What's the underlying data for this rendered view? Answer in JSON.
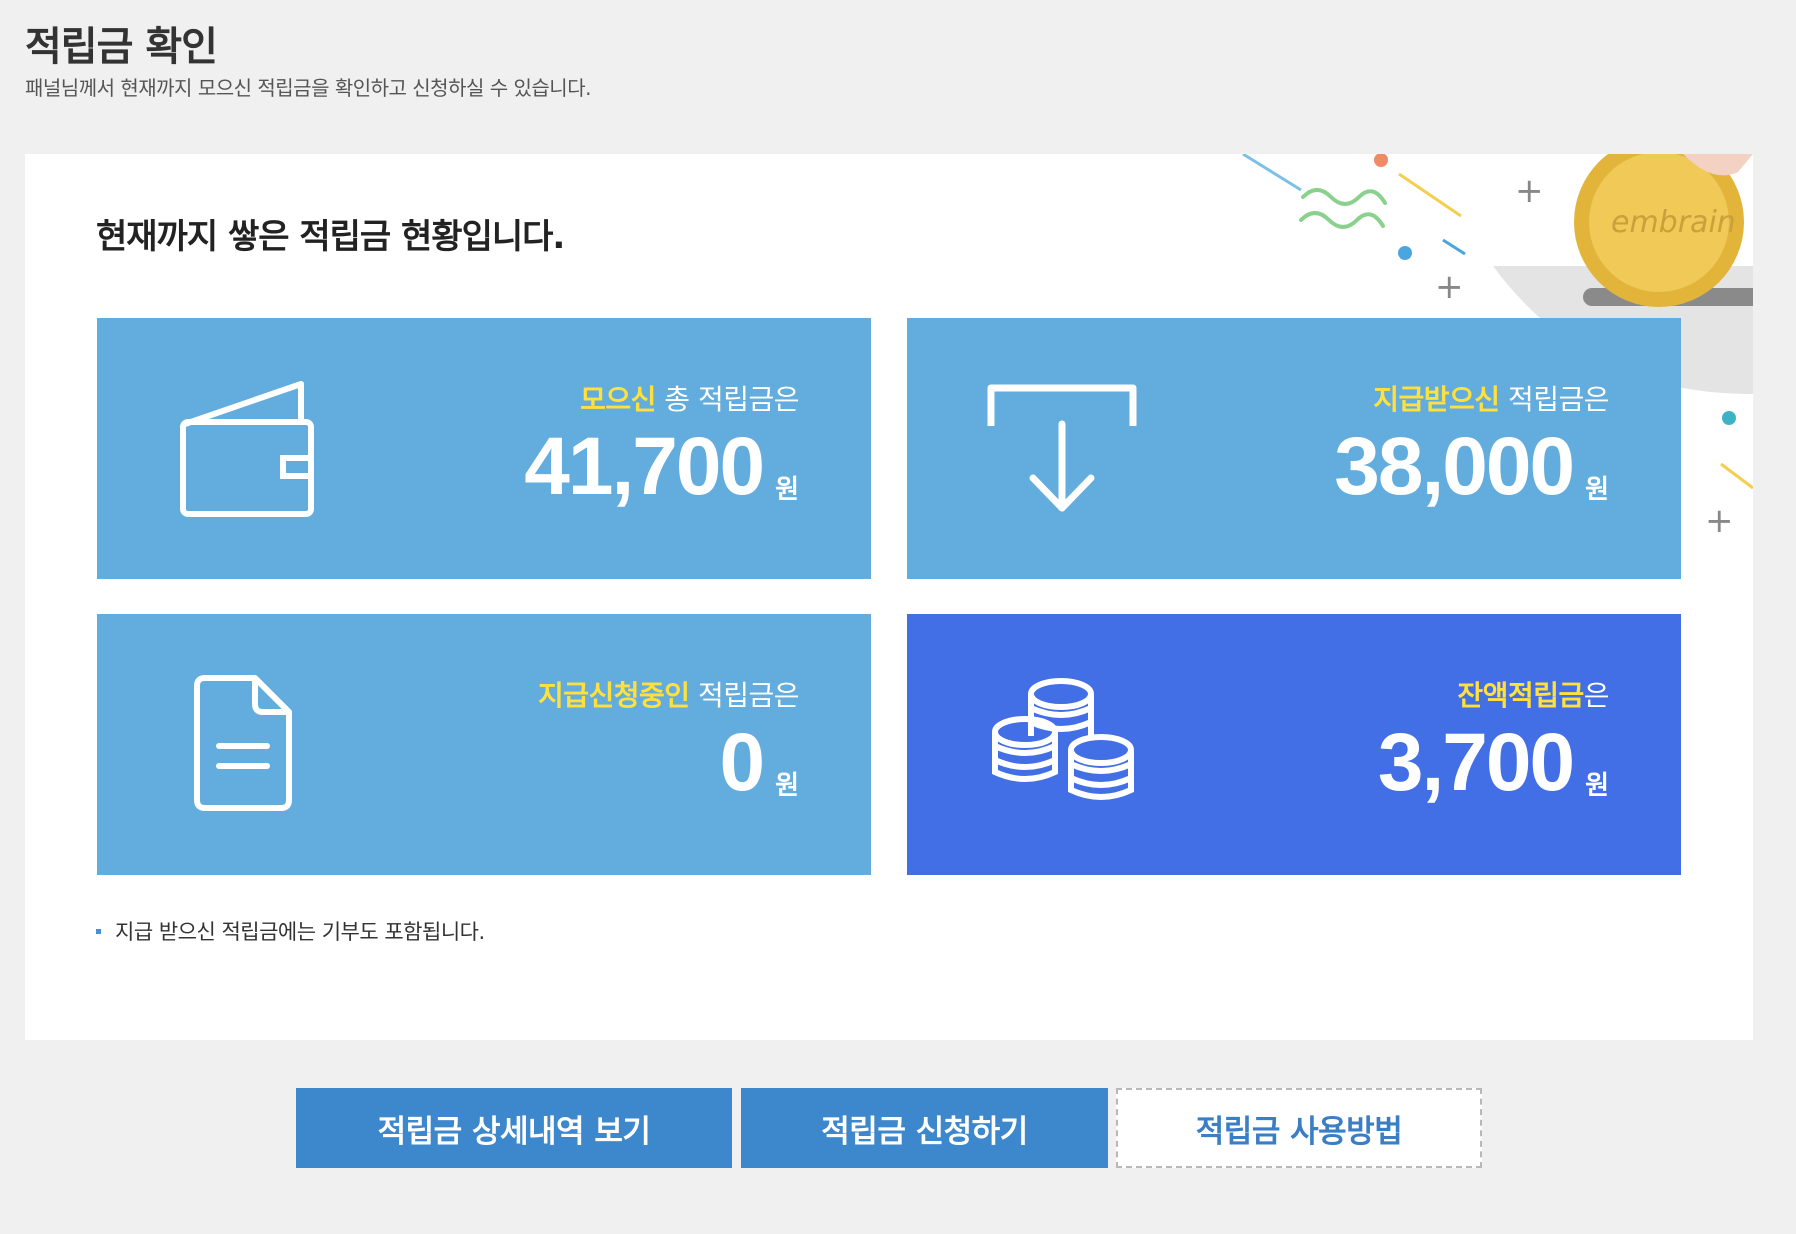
{
  "header": {
    "title": "적립금 확인",
    "subtitle": "패널님께서 현재까지 모으신 적립금을 확인하고 신청하실 수 있습니다."
  },
  "panel": {
    "heading": "현재까지 쌓은 적립금 현황입니다.",
    "brand_text": "embrain",
    "cards": [
      {
        "highlight": "모으신",
        "rest": " 총 적립금은",
        "amount": "41,700",
        "unit": "원",
        "icon": "wallet-icon"
      },
      {
        "highlight": "지급받으신",
        "rest": " 적립금은",
        "amount": "38,000",
        "unit": "원",
        "icon": "download-tray-icon"
      },
      {
        "highlight": "지급신청중인",
        "rest": " 적립금은",
        "amount": "0",
        "unit": "원",
        "icon": "document-icon"
      },
      {
        "highlight": "잔액적립금",
        "rest": "은",
        "amount": "3,700",
        "unit": "원",
        "icon": "coins-stack-icon"
      }
    ],
    "note": "지급 받으신 적립금에는 기부도 포함됩니다."
  },
  "buttons": {
    "details": "적립금 상세내역 보기",
    "apply": "적립금 신청하기",
    "howto": "적립금 사용방법"
  },
  "colors": {
    "card_light": "#62addd",
    "card_dark": "#426ee6",
    "highlight": "#ffe03c",
    "button_primary": "#3d87cc"
  }
}
